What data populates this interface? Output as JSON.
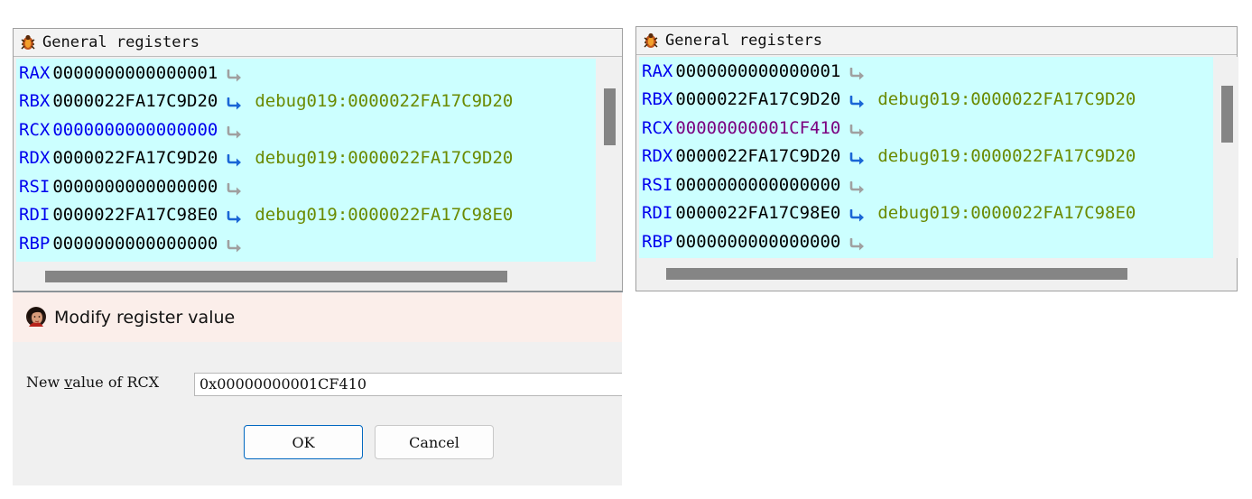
{
  "panels": [
    {
      "title": "General registers",
      "registers": [
        {
          "name": "RAX",
          "value": "0000000000000001",
          "target": ""
        },
        {
          "name": "RBX",
          "value": "0000022FA17C9D20",
          "target": "debug019:0000022FA17C9D20"
        },
        {
          "name": "RCX",
          "value": "0000000000000000",
          "target": ""
        },
        {
          "name": "RDX",
          "value": "0000022FA17C9D20",
          "target": "debug019:0000022FA17C9D20"
        },
        {
          "name": "RSI",
          "value": "0000000000000000",
          "target": ""
        },
        {
          "name": "RDI",
          "value": "0000022FA17C98E0",
          "target": "debug019:0000022FA17C98E0"
        },
        {
          "name": "RBP",
          "value": "0000000000000000",
          "target": ""
        }
      ]
    },
    {
      "title": "General registers",
      "registers": [
        {
          "name": "RAX",
          "value": "0000000000000001",
          "target": ""
        },
        {
          "name": "RBX",
          "value": "0000022FA17C9D20",
          "target": "debug019:0000022FA17C9D20"
        },
        {
          "name": "RCX",
          "value": "00000000001CF410",
          "target": ""
        },
        {
          "name": "RDX",
          "value": "0000022FA17C9D20",
          "target": "debug019:0000022FA17C9D20"
        },
        {
          "name": "RSI",
          "value": "0000000000000000",
          "target": ""
        },
        {
          "name": "RDI",
          "value": "0000022FA17C98E0",
          "target": "debug019:0000022FA17C98E0"
        },
        {
          "name": "RBP",
          "value": "0000000000000000",
          "target": ""
        }
      ]
    }
  ],
  "dialog": {
    "title": "Modify register value",
    "label_prefix": "New ",
    "label_underlined": "v",
    "label_suffix": "alue of RCX",
    "input_value": "0x00000000001CF410",
    "ok_label": "OK",
    "cancel_label": "Cancel"
  },
  "colors": {
    "register_bg": "#ccffff",
    "register_name": "#0000ee",
    "changed_value": "#7a0080",
    "selected_value": "#0000ee",
    "target_text": "#6a8a00",
    "arrow": "#1a66d6",
    "arrow_inactive": "#a0a0a0"
  }
}
